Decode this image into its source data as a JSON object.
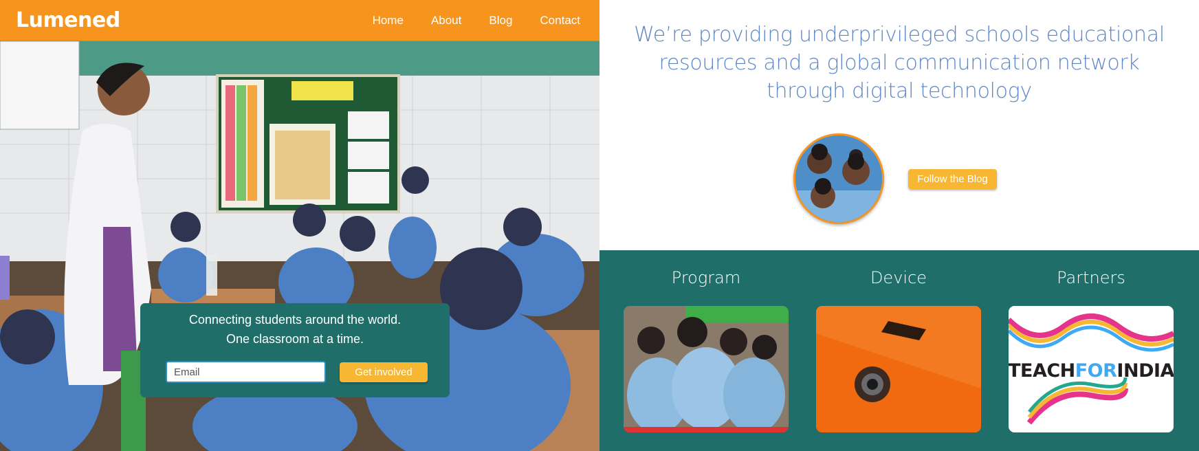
{
  "brand": {
    "name": "Lumened"
  },
  "nav": {
    "items": [
      {
        "label": "Home"
      },
      {
        "label": "About"
      },
      {
        "label": "Blog"
      },
      {
        "label": "Contact"
      }
    ]
  },
  "hero": {
    "line1": "Connecting students around the world.",
    "line2": "One classroom at a time.",
    "email_placeholder": "Email",
    "email_value": "",
    "cta_label": "Get involved"
  },
  "mission": {
    "line1": "We’re providing underprivileged schools educational",
    "line2": "resources and a global communication network",
    "line3": "through digital technology"
  },
  "blog": {
    "follow_label": "Follow the Blog"
  },
  "sections": [
    {
      "title": "Program",
      "image": "students-group-photo"
    },
    {
      "title": "Device",
      "image": "orange-projector-device-photo"
    },
    {
      "title": "Partners",
      "image": "teach-for-india-logo"
    }
  ],
  "partner_logo": {
    "teach": "TEACH",
    "for": "FOR",
    "india": "INDIA"
  },
  "colors": {
    "brand_orange": "#f7941d",
    "button_yellow": "#f7b733",
    "teal": "#1f6e69",
    "mission_blue": "#5b86c8",
    "logo_dark": "#231f20",
    "logo_for": "#3fa9f5"
  }
}
